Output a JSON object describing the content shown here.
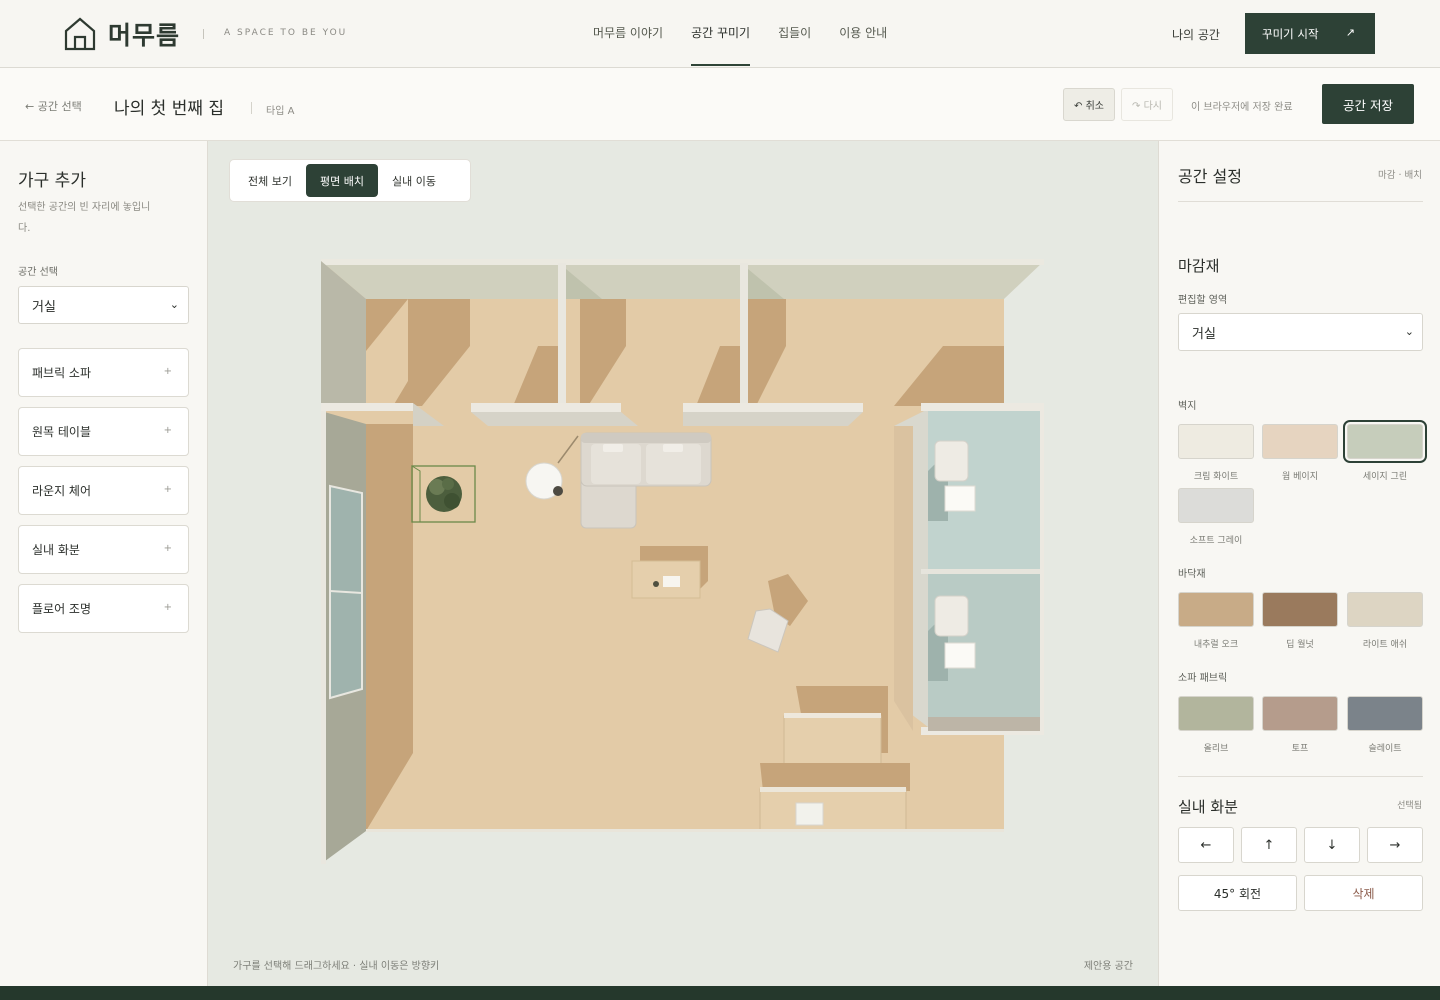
{
  "brand": {
    "name": "머무름",
    "tagline": "A SPACE TO BE YOU"
  },
  "nav": {
    "links": [
      "머무름 이야기",
      "공간 꾸미기",
      "집들이",
      "이용 안내"
    ],
    "active_index": 1,
    "my_space": "나의 공간",
    "start_button": "꾸미기 시작",
    "start_arrow": "↗"
  },
  "subheader": {
    "back": "← 공간 선택",
    "space_name": "나의 첫 번째 집",
    "space_type": "타입 A",
    "undo": "↶ 취소",
    "redo": "↷ 다시",
    "save_status": "이 브라우저에 저장 완료",
    "save_button": "공간 저장"
  },
  "left_panel": {
    "title": "가구 추가",
    "description": "선택한 공간의 빈 자리에 놓입니다.",
    "room_label": "공간 선택",
    "room_value": "거실",
    "add_icon": "+",
    "furniture": [
      "패브릭 소파",
      "원목 테이블",
      "라운지 체어",
      "실내 화분",
      "플로어 조명"
    ]
  },
  "canvas": {
    "view_tabs": [
      "전체 보기",
      "평면 배치",
      "실내 이동"
    ],
    "active_view": 1,
    "hint": "가구를 선택해 드래그하세요 · 실내 이동은 방향키",
    "note": "제안용 공간"
  },
  "right_panel": {
    "title": "공간 설정",
    "breadcrumb": "마감 · 배치",
    "finish_title": "마감재",
    "area_label": "편집할 영역",
    "area_value": "거실",
    "wall_label": "벽지",
    "walls": [
      {
        "name": "크림 화이트",
        "color": "#eeebe1"
      },
      {
        "name": "웜 베이지",
        "color": "#e6d4c0"
      },
      {
        "name": "세이지 그린",
        "color": "#c6cdbb",
        "selected": true
      },
      {
        "name": "소프트 그레이",
        "color": "#dcdcd9"
      }
    ],
    "floor_label": "바닥재",
    "floors": [
      {
        "name": "내추럴 오크",
        "color": "#c8ab87"
      },
      {
        "name": "딥 월넛",
        "color": "#9a7a5d"
      },
      {
        "name": "라이트 애쉬",
        "color": "#ddd5c3"
      }
    ],
    "sofa_label": "소파 패브릭",
    "sofas": [
      {
        "name": "올리브",
        "color": "#b2b59d"
      },
      {
        "name": "토프",
        "color": "#b59c8c"
      },
      {
        "name": "슬레이트",
        "color": "#7b838a"
      }
    ],
    "selected_title": "실내 화분",
    "selected_tag": "선택됨",
    "arrows": [
      "←",
      "↑",
      "↓",
      "→"
    ],
    "rotate": "45° 회전",
    "delete": "삭제",
    "delete_color": "#8a5a4a"
  }
}
